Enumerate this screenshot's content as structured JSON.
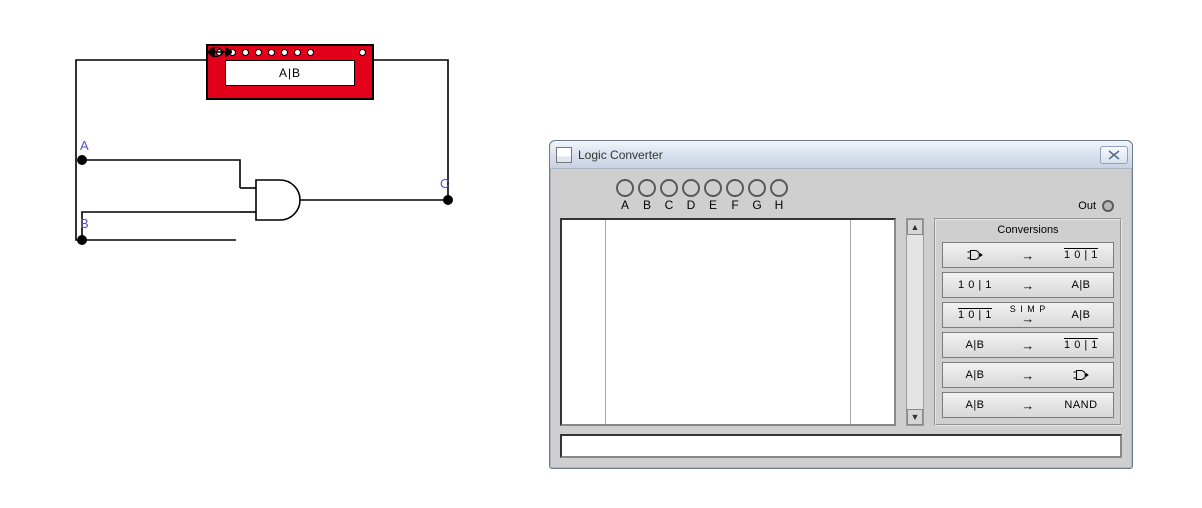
{
  "schematic": {
    "labels": {
      "a": "A",
      "b": "B",
      "c": "C"
    },
    "component_label": "A|B"
  },
  "window": {
    "title": "Logic Converter",
    "inputs": [
      "A",
      "B",
      "C",
      "D",
      "E",
      "F",
      "G",
      "H"
    ],
    "out_label": "Out"
  },
  "conversions": {
    "title": "Conversions",
    "btn1": {
      "left_kind": "gate",
      "right_text": "1 0 | 1",
      "right_overline": true
    },
    "btn2": {
      "left_text": "1 0 | 1",
      "left_overline": false,
      "right_text": "A|B",
      "right_overline": false
    },
    "btn3": {
      "left_text": "1 0 | 1",
      "left_overline": true,
      "mid_text": "S I M P",
      "right_text": "A|B",
      "right_overline": false
    },
    "btn4": {
      "left_text": "A|B",
      "left_overline": false,
      "right_text": "1 0 | 1",
      "right_overline": true
    },
    "btn5": {
      "left_text": "A|B",
      "left_overline": false,
      "right_kind": "gate"
    },
    "btn6": {
      "left_text": "A|B",
      "left_overline": false,
      "right_text": "NAND",
      "right_overline": false
    }
  }
}
